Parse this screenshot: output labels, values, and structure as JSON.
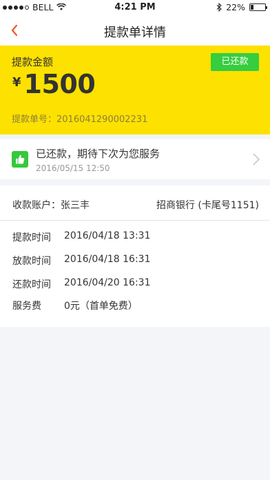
{
  "status_bar": {
    "carrier": "BELL",
    "time": "4:21 PM",
    "battery": "22%",
    "battery_level": 0.22
  },
  "nav": {
    "title": "提款单详情"
  },
  "amount_card": {
    "label": "提款金额",
    "currency": "¥",
    "amount": "1500",
    "status": "已还款",
    "order_no": "提款单号：2016041290002231"
  },
  "notice": {
    "message": "已还款，期待下次为您服务",
    "time": "2016/05/15  12:50"
  },
  "detail": {
    "account": "收款账户：张三丰",
    "bank": "招商银行 (卡尾号1151)",
    "rows": [
      {
        "key": "提款时间",
        "value": "2016/04/18 13:31"
      },
      {
        "key": "放款时间",
        "value": "2016/04/18 16:31"
      },
      {
        "key": "还款时间",
        "value": "2016/04/20 16:31"
      },
      {
        "key": "服务费",
        "value": "0元（首单免费）"
      }
    ]
  },
  "colors": {
    "accent_orange": "#f2562c",
    "card_yellow": "#fde100",
    "status_green": "#36cd3f"
  }
}
